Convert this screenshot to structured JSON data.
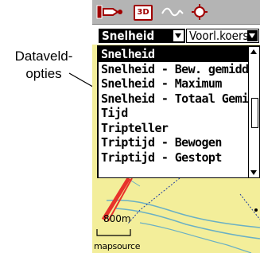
{
  "callout": {
    "line1": "Dataveld-",
    "line2": "opties"
  },
  "status_bar": {
    "icons": [
      "sound-icon",
      "3d-mode-icon",
      "track-icon",
      "sun-icon"
    ],
    "mode_3d": "3D"
  },
  "field_selector": {
    "primary": "Snelheid",
    "secondary": "Voorl.koers"
  },
  "options": [
    "Snelheid",
    "Snelheid - Bew. gemidd",
    "Snelheid - Maximum",
    "Snelheid - Totaal Gemi",
    "Tijd",
    "Tripteller",
    "Triptijd - Bewogen",
    "Triptijd - Gestopt"
  ],
  "selected_index": 0,
  "map": {
    "scale": "800m",
    "brand": "mapsource"
  },
  "colors": {
    "map_bg": "#f3ee9a",
    "water": "#6ab0c4",
    "route": "#e8322b",
    "track": "#1a3aa0"
  }
}
